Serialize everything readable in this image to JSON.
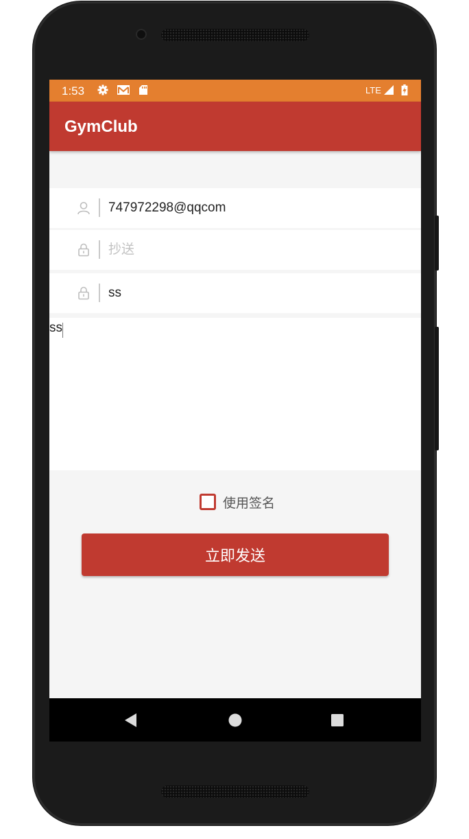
{
  "status_bar": {
    "time": "1:53",
    "icons": [
      "settings-icon",
      "gmail-icon",
      "sd-card-icon"
    ],
    "network": "LTE",
    "right_icons": [
      "signal-icon",
      "battery-charging-icon"
    ],
    "color": "#e47f2f"
  },
  "app_bar": {
    "title": "GymClub",
    "color": "#c03a30"
  },
  "form": {
    "to": {
      "icon": "user-icon",
      "value": "747972298@qqcom"
    },
    "cc": {
      "icon": "lock-icon",
      "value": "",
      "placeholder": "抄送"
    },
    "subject": {
      "icon": "lock-icon",
      "value": "ss"
    },
    "body": {
      "value": "ss"
    }
  },
  "signature": {
    "label": "使用签名",
    "checked": false
  },
  "send_button": {
    "label": "立即发送"
  },
  "nav_bar": {
    "icons": [
      "back-icon",
      "home-icon",
      "recents-icon"
    ]
  }
}
